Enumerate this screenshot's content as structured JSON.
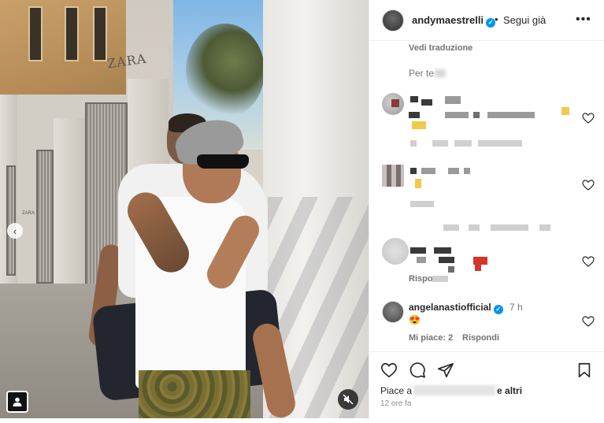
{
  "post": {
    "author": {
      "username": "andymaestrelli",
      "verified": true,
      "follow_label": "Segui già"
    },
    "more_icon": "more-horizontal-icon",
    "see_translation": "Vedi traduzione",
    "caption_tail": "Per te",
    "photo": {
      "storefront_sign": "ZARA",
      "storefront_sign_small": "ZARA"
    }
  },
  "comments": [
    {
      "username": "angelanastiofficial",
      "verified": true,
      "time": "7 h",
      "emoji": "😍",
      "likes_label": "Mi piace: 2",
      "reply_label": "Rispondi"
    }
  ],
  "blurred_reply_label": "Rispo",
  "footer": {
    "likes_prefix": "Piace a",
    "likes_suffix": "e altri",
    "timestamp": "12 ore fa"
  },
  "colors": {
    "verified": "#0095f6",
    "secondary_text": "#737373",
    "primary_text": "#262626"
  }
}
